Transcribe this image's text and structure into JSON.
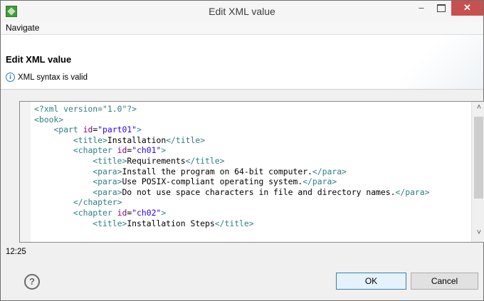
{
  "window": {
    "title": "Edit XML value",
    "minimize": "–",
    "close": "✕"
  },
  "menu": {
    "navigate": "Navigate"
  },
  "header": {
    "title": "Edit XML value",
    "status_icon": "i",
    "status": "XML syntax is valid"
  },
  "editor": {
    "lines": [
      [
        {
          "c": "t",
          "s": "<?xml version=\"1.0\"?>"
        }
      ],
      [
        {
          "c": "t",
          "s": "<book>"
        }
      ],
      [
        {
          "c": "x",
          "s": "    "
        },
        {
          "c": "t",
          "s": "<part"
        },
        {
          "c": "x",
          "s": " "
        },
        {
          "c": "a",
          "s": "id"
        },
        {
          "c": "x",
          "s": "="
        },
        {
          "c": "v",
          "s": "\"part01\""
        },
        {
          "c": "t",
          "s": ">"
        }
      ],
      [
        {
          "c": "x",
          "s": "        "
        },
        {
          "c": "t",
          "s": "<title>"
        },
        {
          "c": "x",
          "s": "Installation"
        },
        {
          "c": "t",
          "s": "</title>"
        }
      ],
      [
        {
          "c": "x",
          "s": "        "
        },
        {
          "c": "t",
          "s": "<chapter"
        },
        {
          "c": "x",
          "s": " "
        },
        {
          "c": "a",
          "s": "id"
        },
        {
          "c": "x",
          "s": "="
        },
        {
          "c": "v",
          "s": "\"ch01\""
        },
        {
          "c": "t",
          "s": ">"
        }
      ],
      [
        {
          "c": "x",
          "s": "            "
        },
        {
          "c": "t",
          "s": "<title>"
        },
        {
          "c": "x",
          "s": "Requirements"
        },
        {
          "c": "t",
          "s": "</title>"
        }
      ],
      [
        {
          "c": "x",
          "s": "            "
        },
        {
          "c": "t",
          "s": "<para>"
        },
        {
          "c": "x",
          "s": "Install the program on 64-bit computer."
        },
        {
          "c": "t",
          "s": "</para>"
        }
      ],
      [
        {
          "c": "x",
          "s": "            "
        },
        {
          "c": "t",
          "s": "<para>"
        },
        {
          "c": "x",
          "s": "Use POSIX-compliant operating system."
        },
        {
          "c": "t",
          "s": "</para>"
        }
      ],
      [
        {
          "c": "x",
          "s": "            "
        },
        {
          "c": "t",
          "s": "<para>"
        },
        {
          "c": "x",
          "s": "Do not use space characters in file and directory names."
        },
        {
          "c": "t",
          "s": "</para>"
        }
      ],
      [
        {
          "c": "x",
          "s": "        "
        },
        {
          "c": "t",
          "s": "</chapter>"
        }
      ],
      [
        {
          "c": "x",
          "s": "        "
        },
        {
          "c": "t",
          "s": "<chapter"
        },
        {
          "c": "x",
          "s": " "
        },
        {
          "c": "a",
          "s": "id"
        },
        {
          "c": "x",
          "s": "="
        },
        {
          "c": "v",
          "s": "\"ch02\""
        },
        {
          "c": "t",
          "s": ">"
        }
      ],
      [
        {
          "c": "x",
          "s": "            "
        },
        {
          "c": "t",
          "s": "<title>"
        },
        {
          "c": "x",
          "s": "Installation Steps"
        },
        {
          "c": "t",
          "s": "</title>"
        }
      ]
    ],
    "scroll_up": "˄",
    "scroll_down": "˅"
  },
  "status": {
    "cursor_position": "12:25"
  },
  "footer": {
    "help": "?",
    "ok_label": "OK",
    "cancel_label": "Cancel"
  },
  "colors": {
    "tag": "#2f7f7f",
    "attribute": "#7f007f",
    "value": "#2a00ff",
    "close_button": "#c75050"
  }
}
